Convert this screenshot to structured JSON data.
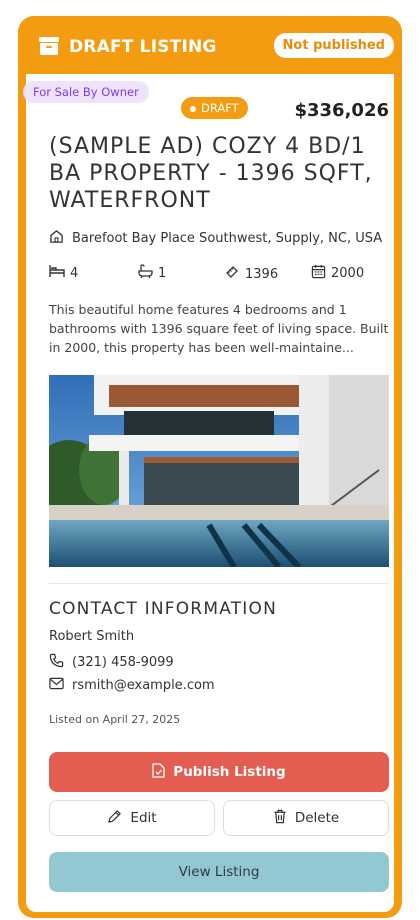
{
  "header": {
    "title": "DRAFT LISTING",
    "status": "Not published",
    "folder_icon": "folder-icon",
    "accent_color": "#f39c12"
  },
  "listing": {
    "sale_badge": "For Sale By Owner",
    "draft_badge": "DRAFT",
    "price": "$336,026",
    "title": "(SAMPLE AD) COZY 4 BD/1 BA PROPERTY - 1396 SQFT, WATERFRONT",
    "address": "Barefoot Bay Place Southwest, Supply, NC, USA",
    "bedrooms": "4",
    "bathrooms": "1",
    "sqft": "1396",
    "year_built": "2000",
    "description": "This beautiful home features 4 bedrooms and 1 bathrooms with 1396 square feet of living space. Built in 2000, this property has been well-maintaine...",
    "photo_alt": "Modern white house with pool"
  },
  "contact": {
    "heading": "CONTACT INFORMATION",
    "name": "Robert Smith",
    "phone": "(321) 458-9099",
    "email": "rsmith@example.com"
  },
  "listed_on": "Listed on April 27, 2025",
  "buttons": {
    "publish": "Publish Listing",
    "edit": "Edit",
    "delete": "Delete",
    "view": "View Listing"
  }
}
